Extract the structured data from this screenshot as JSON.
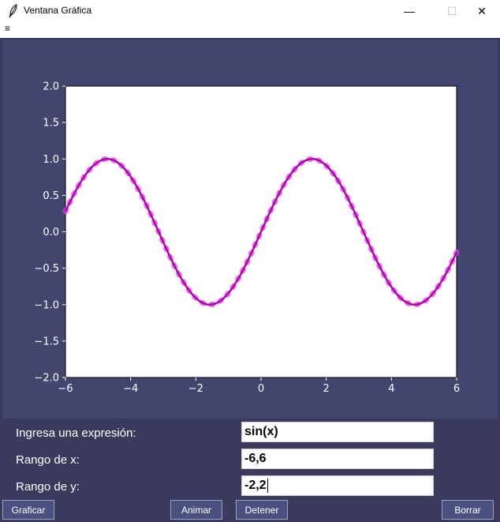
{
  "window": {
    "title": "Ventana Gráfica",
    "minimize": "—",
    "maximize": "☐",
    "close": "✕",
    "menu_glyph": "≡"
  },
  "colors": {
    "plot_bg": "#40466e",
    "curve": "#b000b0",
    "dots": "#e040e0",
    "form_bg": "#3a3a5c"
  },
  "chart_data": {
    "type": "line",
    "series": [
      {
        "name": "",
        "function": "sin(x)",
        "style": "solid"
      },
      {
        "name": "",
        "function": "sin(x)",
        "style": "dotted-markers"
      }
    ],
    "xlim": [
      -6,
      6
    ],
    "ylim": [
      -2,
      2
    ],
    "xticks": [
      -6,
      -4,
      -2,
      0,
      2,
      4,
      6
    ],
    "xtick_labels": [
      "−6",
      "−4",
      "−2",
      "0",
      "2",
      "4",
      "6"
    ],
    "yticks": [
      -2.0,
      -1.5,
      -1.0,
      -0.5,
      0.0,
      0.5,
      1.0,
      1.5,
      2.0
    ],
    "ytick_labels": [
      "−2.0",
      "−1.5",
      "−1.0",
      "−0.5",
      "0.0",
      "0.5",
      "1.0",
      "1.5",
      "2.0"
    ],
    "grid": false
  },
  "form": {
    "expr_label": "Ingresa una expresión:",
    "expr_value": "sin(x)",
    "xrange_label": "Rango de x:",
    "xrange_value": "-6,6",
    "yrange_label": "Rango de y:",
    "yrange_value": "-2,2"
  },
  "buttons": {
    "graficar": "Graficar",
    "animar": "Animar",
    "detener": "Detener",
    "borrar": "Borrar"
  }
}
